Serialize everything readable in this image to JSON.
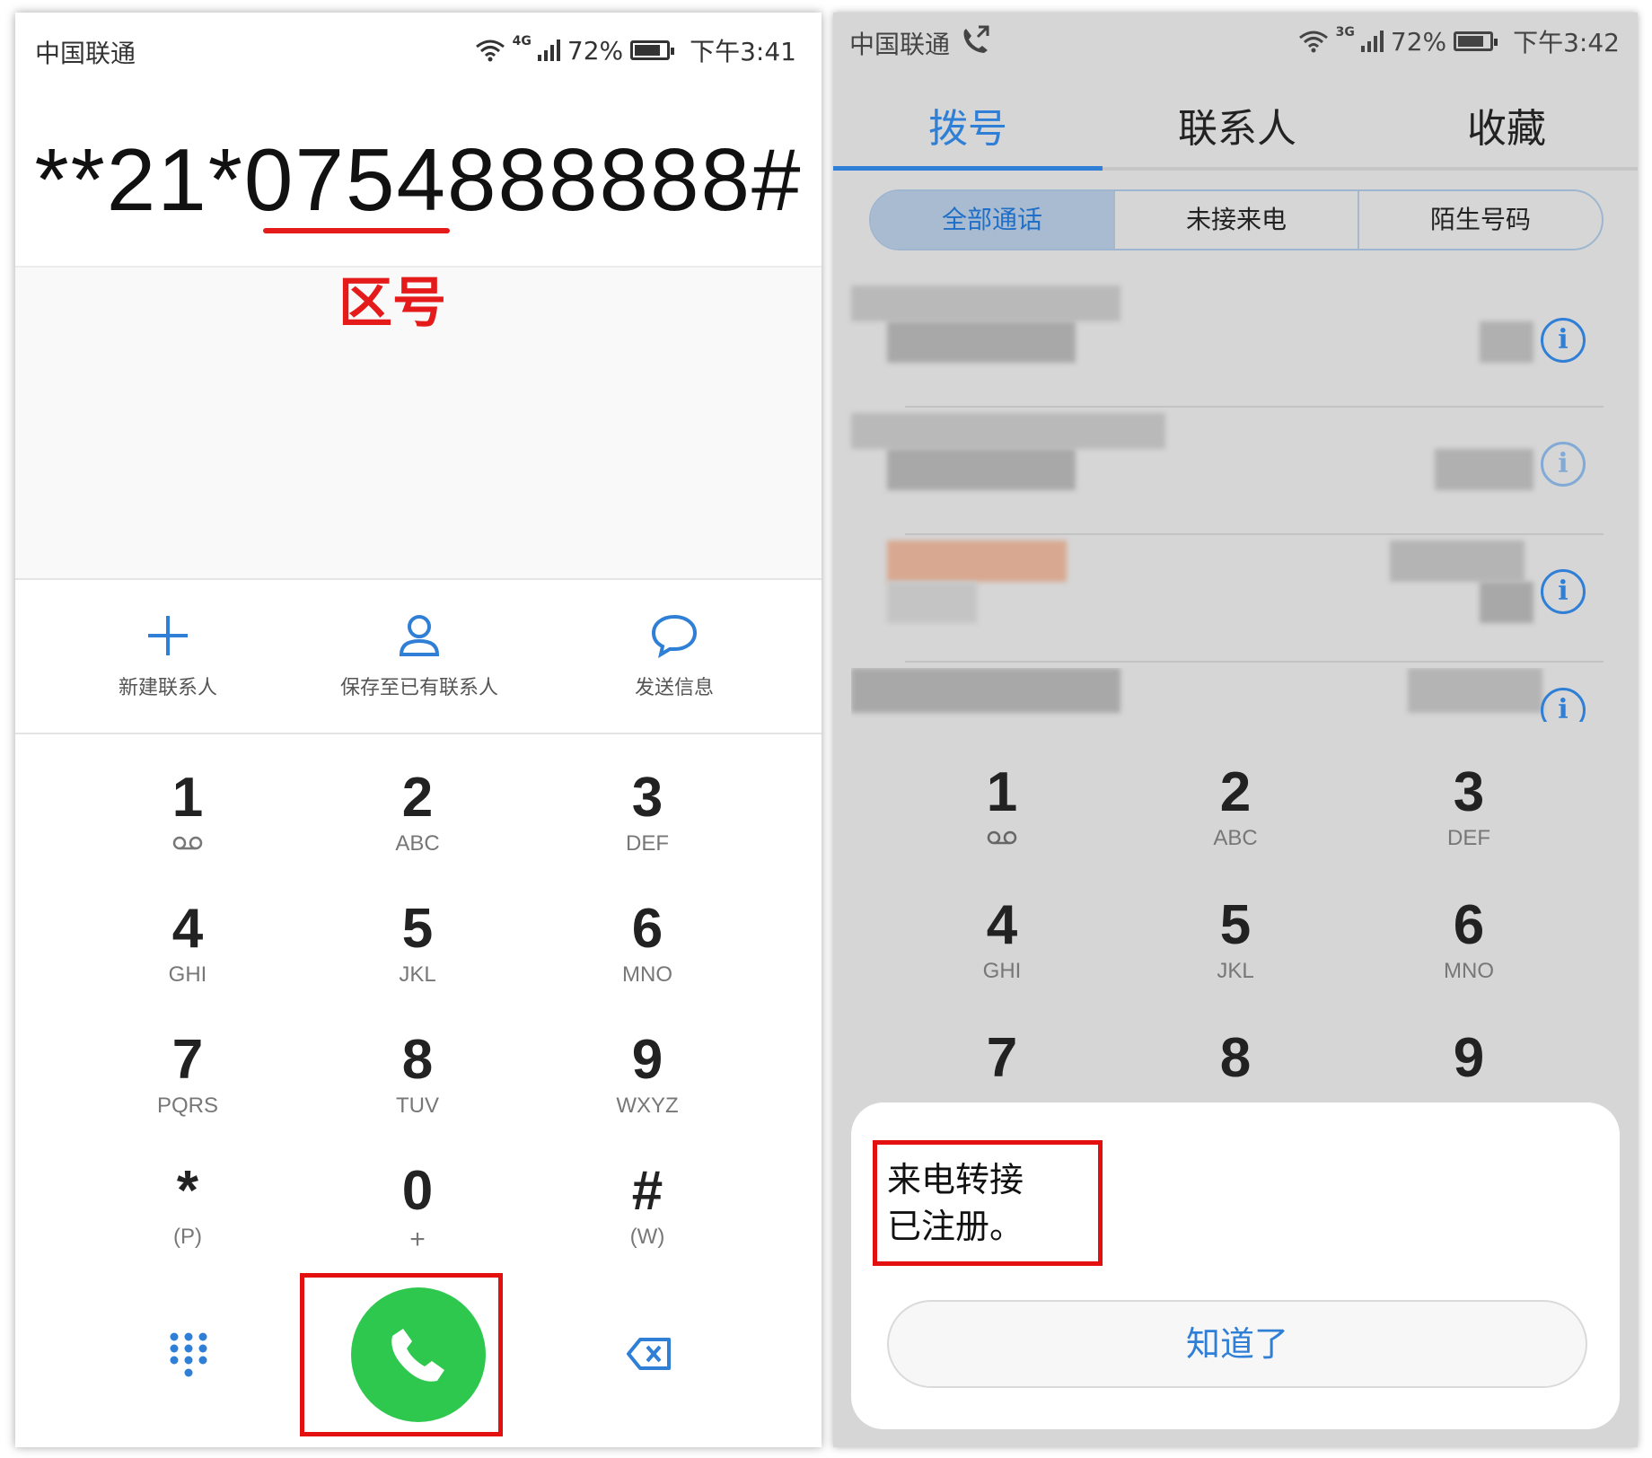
{
  "left": {
    "status": {
      "carrier": "中国联通",
      "network": "4G",
      "battery": "72%",
      "time": "下午3:41"
    },
    "dial_number": "**21*0754888888#",
    "area_label": "区号",
    "actions": [
      {
        "label": "新建联系人"
      },
      {
        "label": "保存至已有联系人"
      },
      {
        "label": "发送信息"
      }
    ],
    "keys": [
      {
        "num": "1",
        "sub": ""
      },
      {
        "num": "2",
        "sub": "ABC"
      },
      {
        "num": "3",
        "sub": "DEF"
      },
      {
        "num": "4",
        "sub": "GHI"
      },
      {
        "num": "5",
        "sub": "JKL"
      },
      {
        "num": "6",
        "sub": "MNO"
      },
      {
        "num": "7",
        "sub": "PQRS"
      },
      {
        "num": "8",
        "sub": "TUV"
      },
      {
        "num": "9",
        "sub": "WXYZ"
      },
      {
        "num": "*",
        "sub": "(P)"
      },
      {
        "num": "0",
        "sub": "+"
      },
      {
        "num": "#",
        "sub": "(W)"
      }
    ],
    "colors": {
      "accent": "#2f7fd6",
      "call": "#2dc84d",
      "highlight": "#e40f0f"
    }
  },
  "right": {
    "status": {
      "carrier": "中国联通",
      "network": "3G",
      "battery": "72%",
      "time": "下午3:42"
    },
    "tabs": [
      {
        "label": "拨号",
        "active": true
      },
      {
        "label": "联系人",
        "active": false
      },
      {
        "label": "收藏",
        "active": false
      }
    ],
    "filters": [
      {
        "label": "全部通话",
        "active": true
      },
      {
        "label": "未接来电",
        "active": false
      },
      {
        "label": "陌生号码",
        "active": false
      }
    ],
    "keys": [
      {
        "num": "1",
        "sub": ""
      },
      {
        "num": "2",
        "sub": "ABC"
      },
      {
        "num": "3",
        "sub": "DEF"
      },
      {
        "num": "4",
        "sub": "GHI"
      },
      {
        "num": "5",
        "sub": "JKL"
      },
      {
        "num": "6",
        "sub": "MNO"
      },
      {
        "num": "7",
        "sub": ""
      },
      {
        "num": "8",
        "sub": ""
      },
      {
        "num": "9",
        "sub": ""
      }
    ],
    "dialog": {
      "message": "来电转接\n已注册。",
      "button": "知道了"
    }
  }
}
